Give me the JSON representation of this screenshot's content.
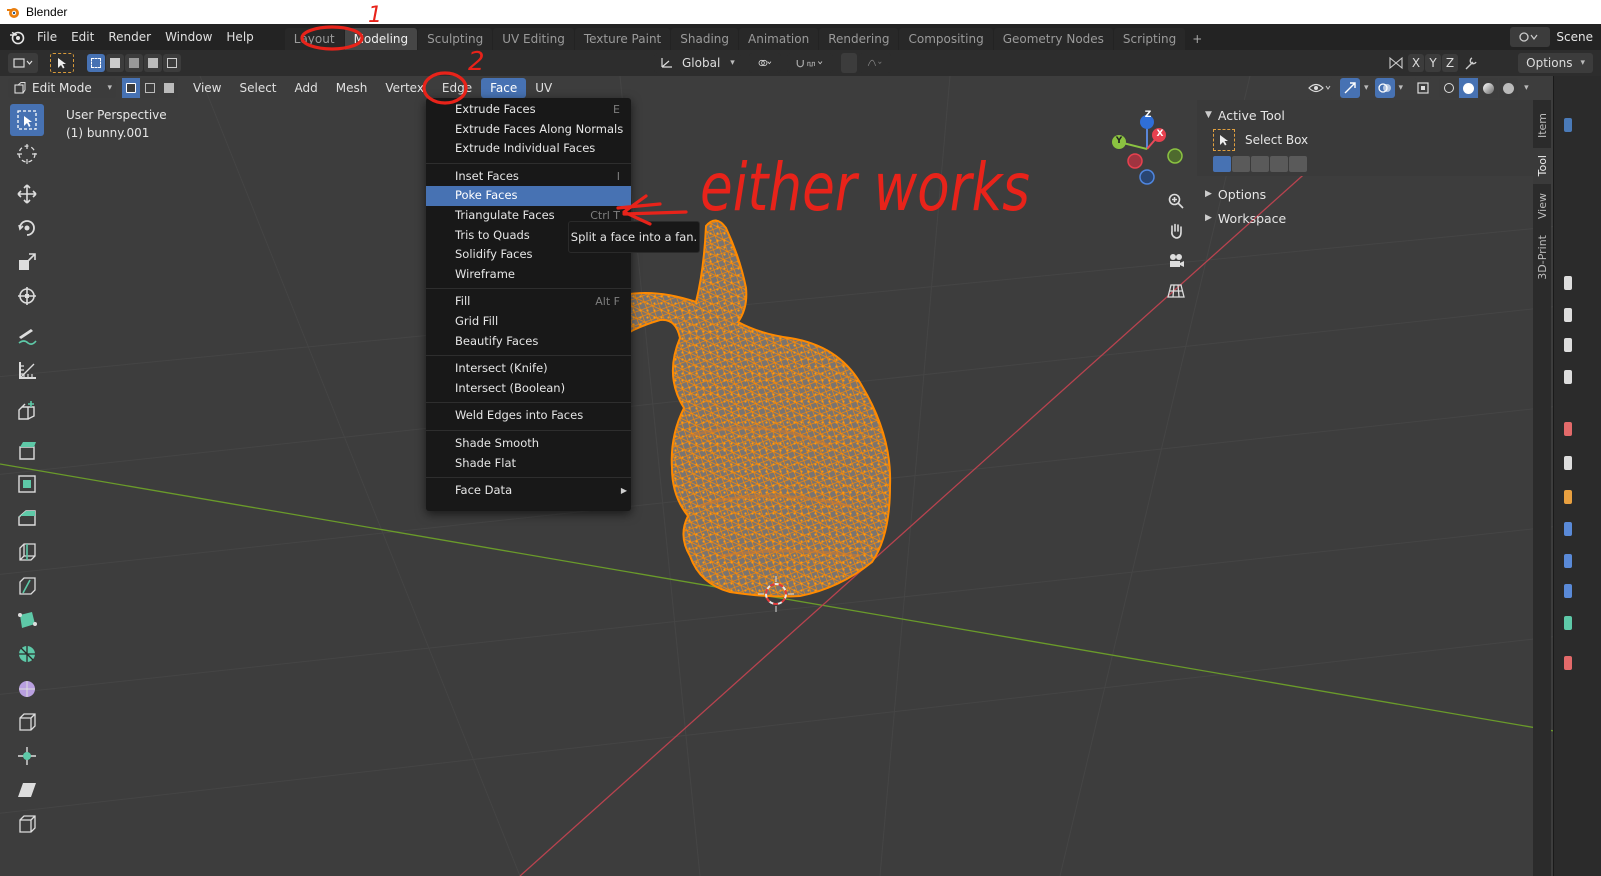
{
  "window": {
    "title": "Blender"
  },
  "menubar": {
    "items": [
      "File",
      "Edit",
      "Render",
      "Window",
      "Help"
    ]
  },
  "workspaces": {
    "tabs": [
      "Layout",
      "Modeling",
      "Sculpting",
      "UV Editing",
      "Texture Paint",
      "Shading",
      "Animation",
      "Rendering",
      "Compositing",
      "Geometry Nodes",
      "Scripting"
    ],
    "active": "Modeling",
    "add_label": "+"
  },
  "scene": {
    "label": "Scene"
  },
  "header": {
    "orientation": "Global",
    "axes": [
      "X",
      "Y",
      "Z"
    ],
    "options_label": "Options"
  },
  "viewport_header": {
    "mode": "Edit Mode",
    "menus": [
      "View",
      "Select",
      "Add",
      "Mesh",
      "Vertex",
      "Edge",
      "Face",
      "UV"
    ],
    "active_menu": "Face"
  },
  "viewport": {
    "perspective": "User Perspective",
    "object": "(1) bunny.001"
  },
  "gizmo": {
    "x": "X",
    "y": "Y",
    "z": "Z"
  },
  "face_menu": {
    "items": [
      {
        "label": "Extrude Faces",
        "shortcut": "E"
      },
      {
        "label": "Extrude Faces Along Normals",
        "shortcut": ""
      },
      {
        "label": "Extrude Individual Faces",
        "shortcut": ""
      },
      {
        "label": "Inset Faces",
        "shortcut": "I"
      },
      {
        "label": "Poke Faces",
        "shortcut": ""
      },
      {
        "label": "Triangulate Faces",
        "shortcut": "Ctrl T"
      },
      {
        "label": "Tris to Quads",
        "shortcut": ""
      },
      {
        "label": "Solidify Faces",
        "shortcut": ""
      },
      {
        "label": "Wireframe",
        "shortcut": ""
      },
      {
        "label": "Fill",
        "shortcut": "Alt F"
      },
      {
        "label": "Grid Fill",
        "shortcut": ""
      },
      {
        "label": "Beautify Faces",
        "shortcut": ""
      },
      {
        "label": "Intersect (Knife)",
        "shortcut": ""
      },
      {
        "label": "Intersect (Boolean)",
        "shortcut": ""
      },
      {
        "label": "Weld Edges into Faces",
        "shortcut": ""
      },
      {
        "label": "Shade Smooth",
        "shortcut": ""
      },
      {
        "label": "Shade Flat",
        "shortcut": ""
      },
      {
        "label": "Face Data",
        "shortcut": ""
      }
    ],
    "highlighted": "Poke Faces",
    "tooltip": "Split a face into a fan."
  },
  "sidebar": {
    "active_tool_title": "Active Tool",
    "tool_name": "Select Box",
    "options_label": "Options",
    "workspace_label": "Workspace",
    "tabs": [
      "Item",
      "Tool",
      "View",
      "3D-Print"
    ],
    "active_tab": "Tool"
  },
  "annotations": {
    "step1": "1",
    "step2": "2",
    "note": "either works",
    "color": "#e8231a"
  },
  "colors": {
    "accent": "#4772b3",
    "mesh_wire": "#ff8a00",
    "x_axis": "#b8434f",
    "y_axis": "#6a9b2a",
    "annotation": "#e8231a"
  }
}
